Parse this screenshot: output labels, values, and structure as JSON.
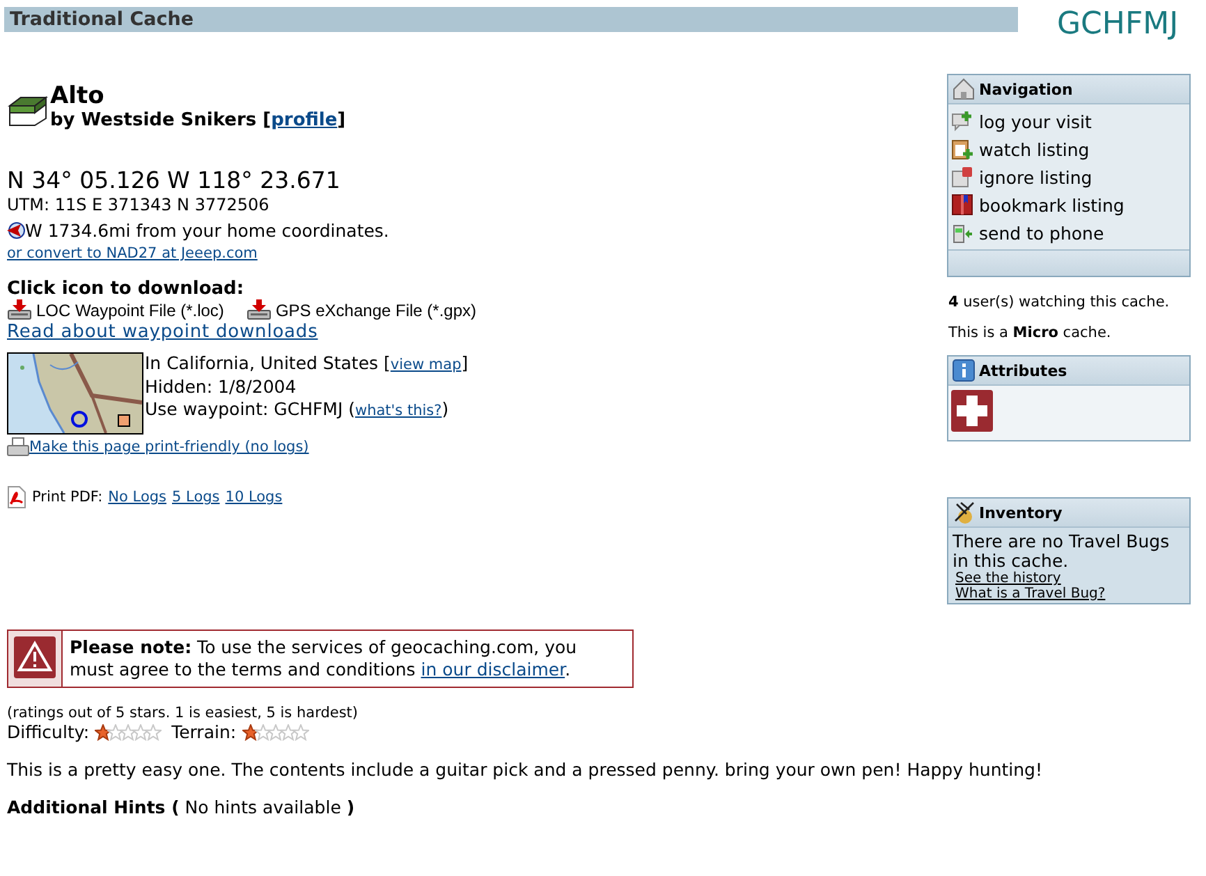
{
  "header": {
    "type_label": "Traditional Cache",
    "code": "GCHFMJ"
  },
  "cache": {
    "name": "Alto",
    "owner_text": "by Westside Snikers [",
    "profile_link": "profile",
    "owner_end": "]"
  },
  "coordinates": {
    "latlon": "N 34° 05.126 W 118° 23.671",
    "utm": "UTM: 11S E 371343 N 3772506",
    "distance": "W 1734.6mi from your home coordinates.",
    "convert_link": "or convert to NAD27 at Jeeep.com"
  },
  "download": {
    "heading": "Click icon to download:",
    "files": [
      {
        "label": "LOC Waypoint File (*.loc)"
      },
      {
        "label": "GPS eXchange File (*.gpx)"
      }
    ],
    "read_link": "Read about waypoint downloads"
  },
  "location": {
    "place": "In California, United States [",
    "map_link": "view map",
    "place_end": "]",
    "hidden": "Hidden: 1/8/2004",
    "waypoint": "Use waypoint: GCHFMJ (",
    "whats_link": "what's this?",
    "waypoint_end": ")"
  },
  "print_friendly": "Make this page print-friendly (no logs)",
  "print_pdf": {
    "label": "Print PDF:",
    "links": [
      "No Logs",
      "5 Logs",
      "10 Logs"
    ]
  },
  "navigation": {
    "title": "Navigation",
    "items": [
      {
        "label": "log your visit"
      },
      {
        "label": "watch listing"
      },
      {
        "label": "ignore listing"
      },
      {
        "label": "bookmark listing"
      },
      {
        "label": "send to phone"
      }
    ]
  },
  "watchers": "**4** user(s) watching this cache.",
  "size_note": "This is a **Micro** cache.",
  "attributes": {
    "title": "Attributes"
  },
  "inventory": {
    "title": "Inventory",
    "text": "There are no Travel Bugs in this cache.",
    "links": [
      "See the history",
      "What is a Travel Bug?"
    ]
  },
  "notice": {
    "text": "**Please note:** To use the services of geocaching.com, you must agree to the terms and conditions ",
    "link": "in our disclaimer",
    "end": "."
  },
  "ratings": {
    "note": "(ratings out of 5 stars. 1 is easiest, 5 is hardest)",
    "items": [
      {
        "label": "Difficulty:",
        "stars": 1
      },
      {
        "label": "Terrain:",
        "stars": 1
      }
    ]
  },
  "description": "This is a pretty easy one. The contents include a guitar pick and a pressed penny. bring your own pen! Happy hunting!",
  "hints": "**Additional Hints (** No hints available **)**"
}
